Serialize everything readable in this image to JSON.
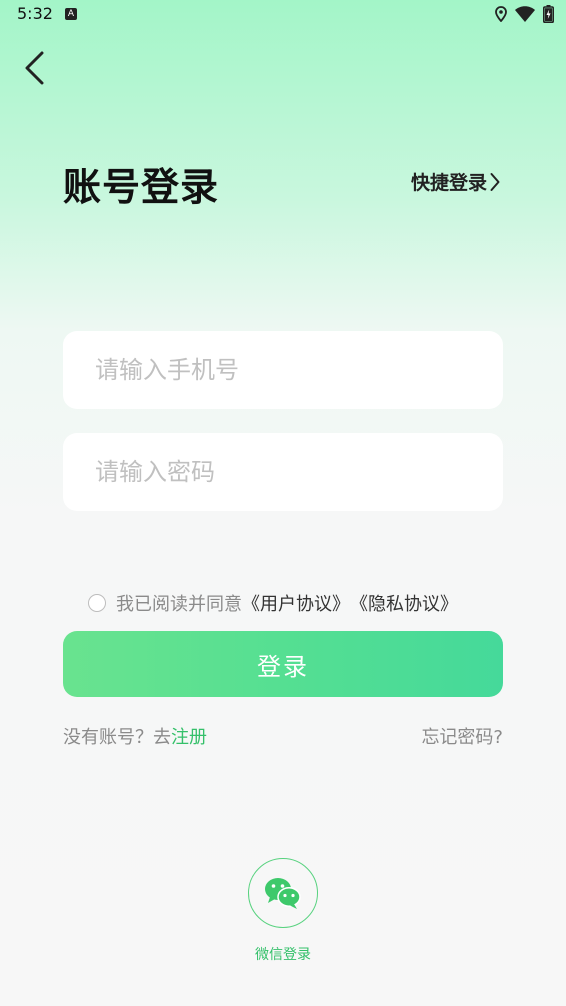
{
  "status_bar": {
    "time": "5:32",
    "icons": [
      "a-notification-icon",
      "location-icon",
      "wifi-icon",
      "battery-charging-icon"
    ]
  },
  "header": {
    "back_icon": "chevron-left-icon",
    "title": "账号登录",
    "quick_login_label": "快捷登录"
  },
  "form": {
    "phone_placeholder": "请输入手机号",
    "phone_value": "",
    "password_placeholder": "请输入密码",
    "password_value": ""
  },
  "agreement": {
    "prefix": "我已阅读并同意",
    "user_agreement": "《用户协议》",
    "privacy_policy": "《隐私协议》",
    "checked": false
  },
  "login_button_label": "登录",
  "register": {
    "prompt": "没有账号？去",
    "link": "注册"
  },
  "forgot_label": "忘记密码?",
  "wechat": {
    "icon": "wechat-icon",
    "label": "微信登录"
  },
  "colors": {
    "accent_green": "#34c06a",
    "button_start": "#69e38f",
    "button_end": "#45d99a",
    "top_gradient": "#a3f5c8"
  }
}
